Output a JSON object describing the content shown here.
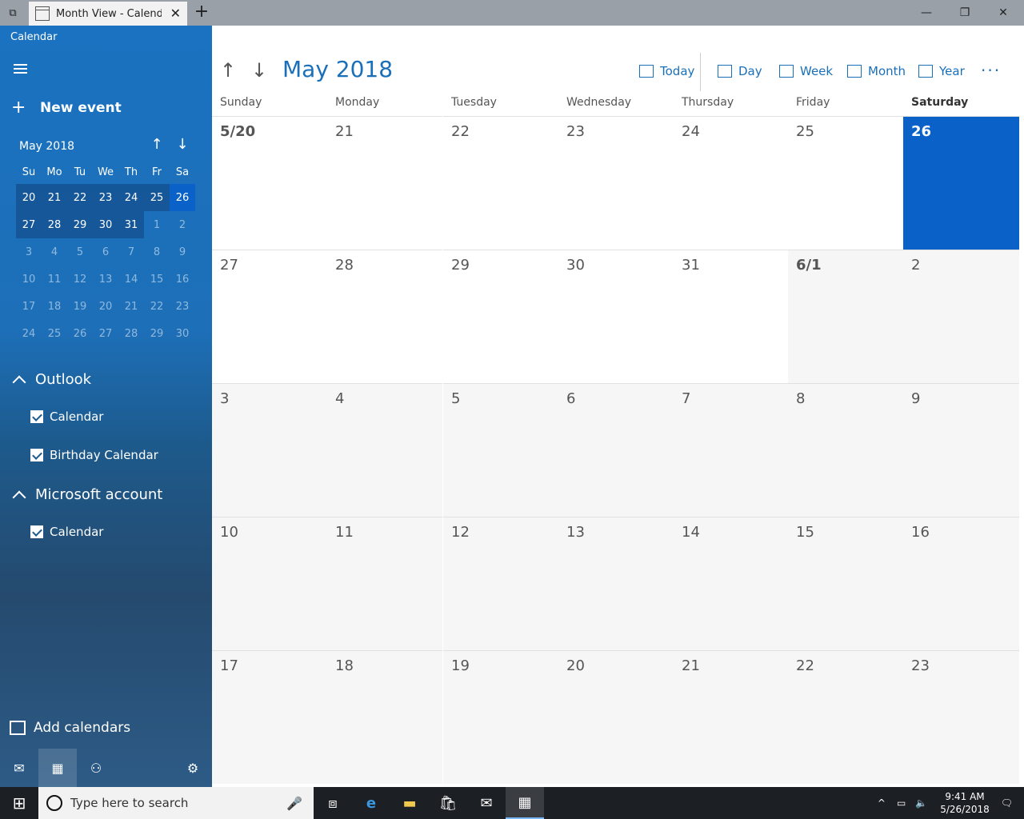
{
  "window": {
    "tab_title": "Month View - Calendar",
    "tab_close": "✕",
    "tab_add": "+",
    "minimize": "—",
    "maximize": "❐",
    "close": "✕"
  },
  "sidebar": {
    "app_name": "Calendar",
    "new_event": "New event",
    "mini_calendar": {
      "title": "May 2018",
      "day_headers": [
        "Su",
        "Mo",
        "Tu",
        "We",
        "Th",
        "Fr",
        "Sa"
      ],
      "weeks": [
        [
          "20",
          "21",
          "22",
          "23",
          "24",
          "25",
          "26"
        ],
        [
          "27",
          "28",
          "29",
          "30",
          "31",
          "1",
          "2"
        ],
        [
          "3",
          "4",
          "5",
          "6",
          "7",
          "8",
          "9"
        ],
        [
          "10",
          "11",
          "12",
          "13",
          "14",
          "15",
          "16"
        ],
        [
          "17",
          "18",
          "19",
          "20",
          "21",
          "22",
          "23"
        ],
        [
          "24",
          "25",
          "26",
          "27",
          "28",
          "29",
          "30"
        ]
      ],
      "selected": "26"
    },
    "groups": [
      {
        "name": "Outlook",
        "calendars": [
          "Calendar",
          "Birthday Calendar"
        ]
      },
      {
        "name": "Microsoft account",
        "calendars": [
          "Calendar"
        ]
      }
    ],
    "add_calendars": "Add calendars"
  },
  "main": {
    "title": "May 2018",
    "toolbar": {
      "today": "Today",
      "day": "Day",
      "week": "Week",
      "month": "Month",
      "year": "Year",
      "more": "···"
    },
    "day_headers": [
      "Sunday",
      "Monday",
      "Tuesday",
      "Wednesday",
      "Thursday",
      "Friday",
      "Saturday"
    ],
    "weeks": [
      [
        "5/20",
        "21",
        "22",
        "23",
        "24",
        "25",
        "26"
      ],
      [
        "27",
        "28",
        "29",
        "30",
        "31",
        "6/1",
        "2"
      ],
      [
        "3",
        "4",
        "5",
        "6",
        "7",
        "8",
        "9"
      ],
      [
        "10",
        "11",
        "12",
        "13",
        "14",
        "15",
        "16"
      ],
      [
        "17",
        "18",
        "19",
        "20",
        "21",
        "22",
        "23"
      ]
    ],
    "today": "26"
  },
  "taskbar": {
    "search_placeholder": "Type here to search",
    "time": "9:41 AM",
    "date": "5/26/2018"
  },
  "colors": {
    "accent": "#1a6fb9",
    "selected": "#0a62c8"
  }
}
